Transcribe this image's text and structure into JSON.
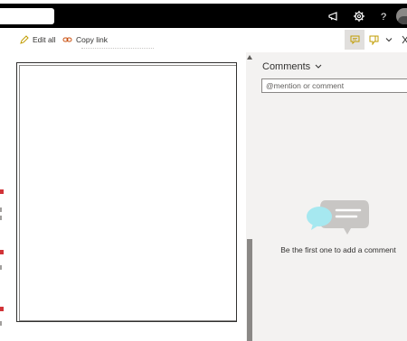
{
  "topbar": {
    "icons": [
      "megaphone-icon",
      "gear-icon",
      "help-icon",
      "avatar"
    ]
  },
  "toolbar": {
    "edit_all_label": "Edit all",
    "copy_link_label": "Copy link"
  },
  "comments": {
    "title": "Comments",
    "input_placeholder": "@mention or comment",
    "empty_message": "Be the first one to add a comment"
  },
  "colors": {
    "topbar": "#000000",
    "pane_background": "#f3f2f1",
    "accent_cyan": "#a6e8f0",
    "bubble_gray": "#c8c6c4",
    "edit_icon": "#c19c00",
    "copy_icon": "#ca5010"
  }
}
